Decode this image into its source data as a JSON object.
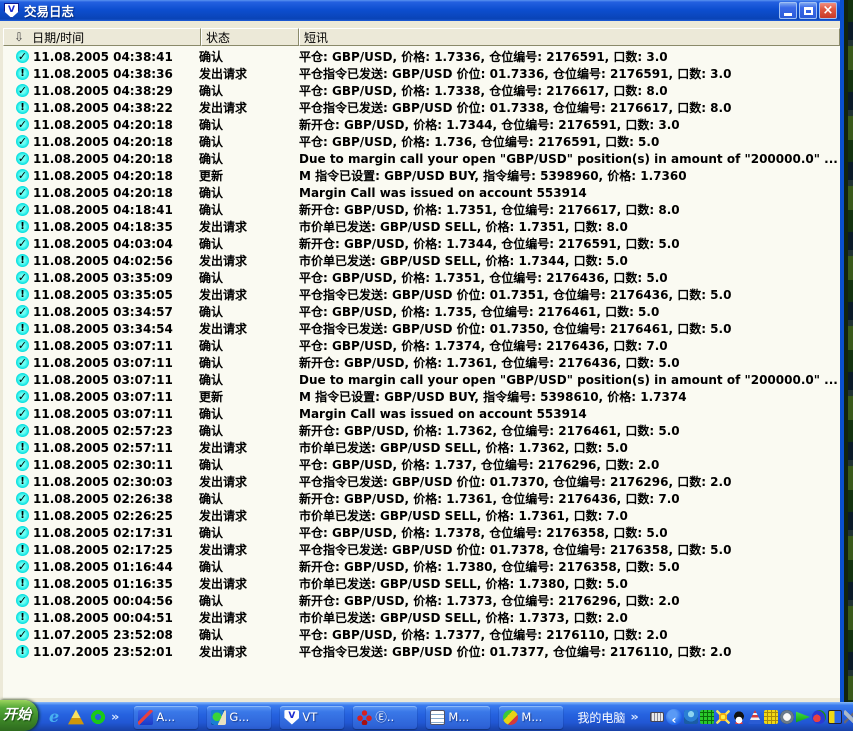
{
  "colors": {
    "titlebar_blue": "#0D4ED0",
    "taskbar_blue": "#2157D4",
    "close_button_red": "#D84A36",
    "status_icon_cyan": "#00DEDE",
    "header_beige": "#ECE9D8",
    "start_button_green": "#3E8A28"
  },
  "window": {
    "title": "交易日志",
    "logo_text": "V"
  },
  "table": {
    "columns": [
      "日期/时间",
      "状态",
      "短讯"
    ],
    "rows": [
      {
        "icon": "check",
        "datetime": "11.08.2005 04:38:41",
        "status": "确认",
        "message": "平仓: GBP/USD, 价格: 1.7336, 仓位编号: 2176591, 口数: 3.0"
      },
      {
        "icon": "exclaim",
        "datetime": "11.08.2005 04:38:36",
        "status": "发出请求",
        "message": "平仓指令已发送: GBP/USD 价位: 01.7336, 仓位编号: 2176591, 口数: 3.0"
      },
      {
        "icon": "check",
        "datetime": "11.08.2005 04:38:29",
        "status": "确认",
        "message": "平仓: GBP/USD, 价格: 1.7338, 仓位编号: 2176617, 口数: 8.0"
      },
      {
        "icon": "exclaim",
        "datetime": "11.08.2005 04:38:22",
        "status": "发出请求",
        "message": "平仓指令已发送: GBP/USD 价位: 01.7338, 仓位编号: 2176617, 口数: 8.0"
      },
      {
        "icon": "check",
        "datetime": "11.08.2005 04:20:18",
        "status": "确认",
        "message": "新开仓: GBP/USD, 价格: 1.7344, 仓位编号: 2176591, 口数: 3.0"
      },
      {
        "icon": "check",
        "datetime": "11.08.2005 04:20:18",
        "status": "确认",
        "message": "平仓: GBP/USD, 价格: 1.736, 仓位编号: 2176591, 口数: 5.0"
      },
      {
        "icon": "check",
        "datetime": "11.08.2005 04:20:18",
        "status": "确认",
        "message": "Due to margin call your open  \"GBP/USD\" position(s) in amount of \"200000.0\" ..."
      },
      {
        "icon": "check",
        "datetime": "11.08.2005 04:20:18",
        "status": "更新",
        "message": "M 指令已设置: GBP/USD BUY, 指令编号: 5398960, 价格: 1.7360"
      },
      {
        "icon": "check",
        "datetime": "11.08.2005 04:20:18",
        "status": "确认",
        "message": "Margin Call was issued on account 553914"
      },
      {
        "icon": "check",
        "datetime": "11.08.2005 04:18:41",
        "status": "确认",
        "message": "新开仓: GBP/USD, 价格: 1.7351, 仓位编号: 2176617, 口数: 8.0"
      },
      {
        "icon": "exclaim",
        "datetime": "11.08.2005 04:18:35",
        "status": "发出请求",
        "message": "市价单已发送: GBP/USD SELL, 价格: 1.7351, 口数: 8.0"
      },
      {
        "icon": "check",
        "datetime": "11.08.2005 04:03:04",
        "status": "确认",
        "message": "新开仓: GBP/USD, 价格: 1.7344, 仓位编号: 2176591, 口数: 5.0"
      },
      {
        "icon": "exclaim",
        "datetime": "11.08.2005 04:02:56",
        "status": "发出请求",
        "message": "市价单已发送: GBP/USD SELL, 价格: 1.7344, 口数: 5.0"
      },
      {
        "icon": "check",
        "datetime": "11.08.2005 03:35:09",
        "status": "确认",
        "message": "平仓: GBP/USD, 价格: 1.7351, 仓位编号: 2176436, 口数: 5.0"
      },
      {
        "icon": "exclaim",
        "datetime": "11.08.2005 03:35:05",
        "status": "发出请求",
        "message": "平仓指令已发送: GBP/USD 价位: 01.7351, 仓位编号: 2176436, 口数: 5.0"
      },
      {
        "icon": "check",
        "datetime": "11.08.2005 03:34:57",
        "status": "确认",
        "message": "平仓: GBP/USD, 价格: 1.735, 仓位编号: 2176461, 口数: 5.0"
      },
      {
        "icon": "exclaim",
        "datetime": "11.08.2005 03:34:54",
        "status": "发出请求",
        "message": "平仓指令已发送: GBP/USD 价位: 01.7350, 仓位编号: 2176461, 口数: 5.0"
      },
      {
        "icon": "check",
        "datetime": "11.08.2005 03:07:11",
        "status": "确认",
        "message": "平仓: GBP/USD, 价格: 1.7374, 仓位编号: 2176436, 口数: 7.0"
      },
      {
        "icon": "check",
        "datetime": "11.08.2005 03:07:11",
        "status": "确认",
        "message": "新开仓: GBP/USD, 价格: 1.7361, 仓位编号: 2176436, 口数: 5.0"
      },
      {
        "icon": "check",
        "datetime": "11.08.2005 03:07:11",
        "status": "确认",
        "message": "Due to margin call your open  \"GBP/USD\" position(s) in amount of \"200000.0\" ..."
      },
      {
        "icon": "check",
        "datetime": "11.08.2005 03:07:11",
        "status": "更新",
        "message": "M 指令已设置: GBP/USD BUY, 指令编号: 5398610, 价格: 1.7374"
      },
      {
        "icon": "check",
        "datetime": "11.08.2005 03:07:11",
        "status": "确认",
        "message": "Margin Call was issued on account 553914"
      },
      {
        "icon": "check",
        "datetime": "11.08.2005 02:57:23",
        "status": "确认",
        "message": "新开仓: GBP/USD, 价格: 1.7362, 仓位编号: 2176461, 口数: 5.0"
      },
      {
        "icon": "exclaim",
        "datetime": "11.08.2005 02:57:11",
        "status": "发出请求",
        "message": "市价单已发送: GBP/USD SELL, 价格: 1.7362, 口数: 5.0"
      },
      {
        "icon": "check",
        "datetime": "11.08.2005 02:30:11",
        "status": "确认",
        "message": "平仓: GBP/USD, 价格: 1.737, 仓位编号: 2176296, 口数: 2.0"
      },
      {
        "icon": "exclaim",
        "datetime": "11.08.2005 02:30:03",
        "status": "发出请求",
        "message": "平仓指令已发送: GBP/USD 价位: 01.7370, 仓位编号: 2176296, 口数: 2.0"
      },
      {
        "icon": "check",
        "datetime": "11.08.2005 02:26:38",
        "status": "确认",
        "message": "新开仓: GBP/USD, 价格: 1.7361, 仓位编号: 2176436, 口数: 7.0"
      },
      {
        "icon": "exclaim",
        "datetime": "11.08.2005 02:26:25",
        "status": "发出请求",
        "message": "市价单已发送: GBP/USD SELL, 价格: 1.7361, 口数: 7.0"
      },
      {
        "icon": "check",
        "datetime": "11.08.2005 02:17:31",
        "status": "确认",
        "message": "平仓: GBP/USD, 价格: 1.7378, 仓位编号: 2176358, 口数: 5.0"
      },
      {
        "icon": "exclaim",
        "datetime": "11.08.2005 02:17:25",
        "status": "发出请求",
        "message": "平仓指令已发送: GBP/USD 价位: 01.7378, 仓位编号: 2176358, 口数: 5.0"
      },
      {
        "icon": "check",
        "datetime": "11.08.2005 01:16:44",
        "status": "确认",
        "message": "新开仓: GBP/USD, 价格: 1.7380, 仓位编号: 2176358, 口数: 5.0"
      },
      {
        "icon": "exclaim",
        "datetime": "11.08.2005 01:16:35",
        "status": "发出请求",
        "message": "市价单已发送: GBP/USD SELL, 价格: 1.7380, 口数: 5.0"
      },
      {
        "icon": "check",
        "datetime": "11.08.2005 00:04:56",
        "status": "确认",
        "message": "新开仓: GBP/USD, 价格: 1.7373, 仓位编号: 2176296, 口数: 2.0"
      },
      {
        "icon": "exclaim",
        "datetime": "11.08.2005 00:04:51",
        "status": "发出请求",
        "message": "市价单已发送: GBP/USD SELL, 价格: 1.7373, 口数: 2.0"
      },
      {
        "icon": "check",
        "datetime": "11.07.2005 23:52:08",
        "status": "确认",
        "message": "平仓: GBP/USD, 价格: 1.7377, 仓位编号: 2176110, 口数: 2.0"
      },
      {
        "icon": "exclaim",
        "datetime": "11.07.2005 23:52:01",
        "status": "发出请求",
        "message": "平仓指令已发送: GBP/USD 价位: 01.7377, 仓位编号: 2176110, 口数: 2.0"
      }
    ]
  },
  "taskbar": {
    "start_label": "开始",
    "chevron": "»",
    "quicklaunch": [
      "internet-explorer",
      "daemon-triangle",
      "sync"
    ],
    "buttons": [
      {
        "icon": "chart",
        "label": "A..."
      },
      {
        "icon": "globe",
        "label": "G..."
      },
      {
        "icon": "vt",
        "label": "VT"
      },
      {
        "icon": "red-cluster",
        "label": "Ⓔ.."
      },
      {
        "icon": "document",
        "label": "M..."
      },
      {
        "icon": "colorful",
        "label": "M..."
      }
    ],
    "toolbar_label": "我的电脑",
    "tray_icons": [
      "keyboard",
      "language-bar",
      "messenger",
      "stock-grid",
      "firework",
      "qq",
      "pagoda",
      "yellow-grid",
      "gauge",
      "green-arrow",
      "swirl",
      "split-color",
      "sword"
    ]
  }
}
